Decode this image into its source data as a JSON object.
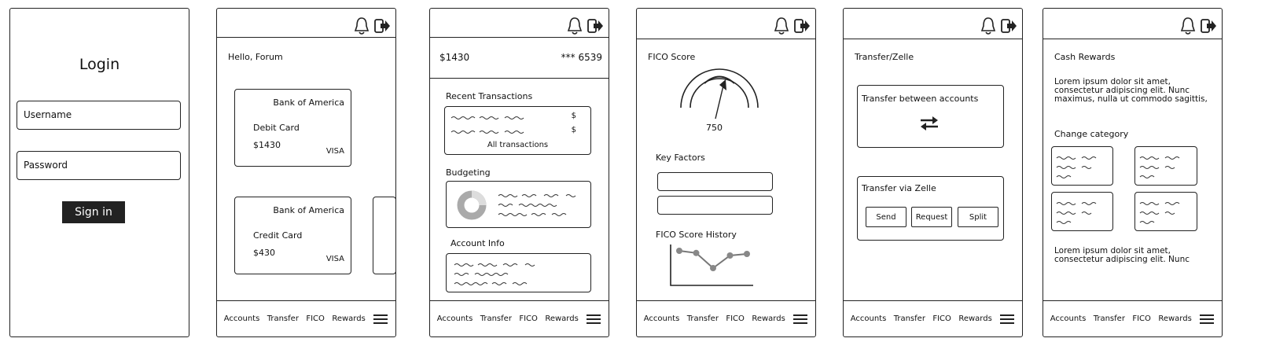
{
  "login": {
    "title": "Login",
    "username_placeholder": "Username",
    "password_placeholder": "Password",
    "signin_label": "Sign in"
  },
  "nav": {
    "accounts": "Accounts",
    "transfer": "Transfer",
    "fico": "FICO",
    "rewards": "Rewards"
  },
  "icons": {
    "bell": "bell-icon",
    "logout": "logout-icon",
    "menu": "hamburger-menu-icon",
    "swap": "swap-arrows-icon"
  },
  "accounts": {
    "greeting": "Hello, Forum",
    "cards": [
      {
        "bank": "Bank of America",
        "type": "Debit Card",
        "amount": "$1430",
        "network": "VISA"
      },
      {
        "bank": "Bank of America",
        "type": "Credit Card",
        "amount": "$430",
        "network": "VISA"
      }
    ]
  },
  "detail": {
    "balance": "$1430",
    "account_masked": "*** 6539",
    "recent_title": "Recent Transactions",
    "currency_symbol": "$",
    "all_transactions": "All transactions",
    "budgeting_title": "Budgeting",
    "account_info_title": "Account Info"
  },
  "fico": {
    "title": "FICO Score",
    "score": "750",
    "key_factors": "Key Factors",
    "history_title": "FICO Score History",
    "history_values": [
      0.85,
      0.78,
      0.3,
      0.7,
      0.75
    ]
  },
  "transfer": {
    "title": "Transfer/Zelle",
    "between": "Transfer between accounts",
    "zelle": "Transfer via Zelle",
    "send": "Send",
    "request": "Request",
    "split": "Split"
  },
  "rewards": {
    "title": "Cash Rewards",
    "lorem": "Lorem ipsum dolor sit amet, consectetur adipiscing elit. Nunc maximus, nulla ut commodo sagittis,",
    "change_category": "Change category",
    "lorem2": "Lorem ipsum dolor sit amet, consectetur adipiscing elit. Nunc"
  }
}
